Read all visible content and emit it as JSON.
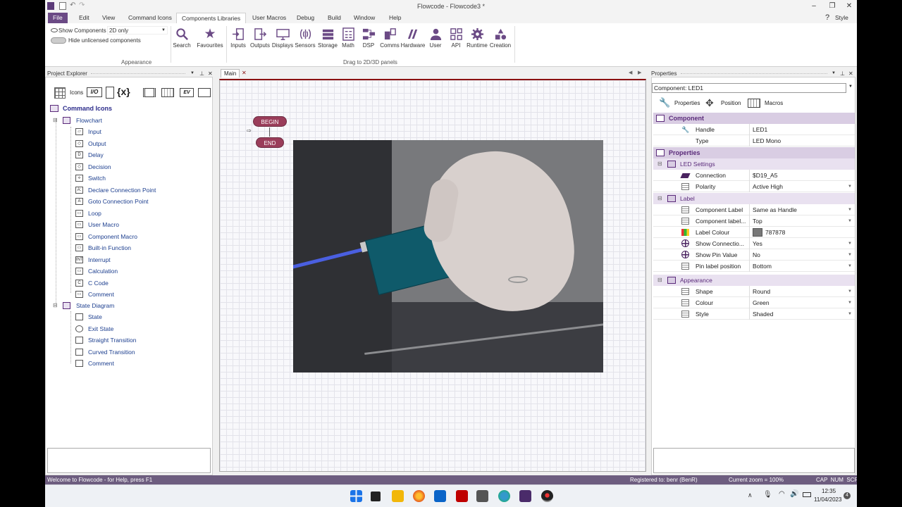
{
  "window": {
    "title": "Flowcode - Flowcode3 *",
    "style_label": "Style"
  },
  "menu": {
    "items": [
      "File",
      "Edit",
      "View",
      "Command Icons",
      "Components Libraries",
      "User Macros",
      "Debug",
      "Build",
      "Window",
      "Help"
    ],
    "active": "Components Libraries"
  },
  "ribbon": {
    "show_components_label": "Show Components",
    "show_components_value": "2D only",
    "hide_unlicensed_label": "Hide unlicensed components",
    "appearance_group": "Appearance",
    "drag_group": "Drag to 2D/3D panels",
    "search": "Search",
    "favourites": "Favourites",
    "libraries": [
      "Inputs",
      "Outputs",
      "Displays",
      "Sensors",
      "Storage",
      "Math",
      "DSP",
      "Comms",
      "Hardware",
      "User",
      "API",
      "Runtime",
      "Creation"
    ]
  },
  "explorer": {
    "title": "Project Explorer",
    "icons_label": "Icons",
    "root": "Command Icons",
    "flowchart": {
      "label": "Flowchart",
      "items": [
        "Input",
        "Output",
        "Delay",
        "Decision",
        "Switch",
        "Declare Connection Point",
        "Goto Connection Point",
        "Loop",
        "User Macro",
        "Component Macro",
        "Built-in Function",
        "Interrupt",
        "Calculation",
        "C Code",
        "Comment"
      ]
    },
    "state_diagram": {
      "label": "State Diagram",
      "items": [
        "State",
        "Exit State",
        "Straight Transition",
        "Curved Transition",
        "Comment"
      ]
    }
  },
  "editor": {
    "tab": "Main",
    "begin": "BEGIN",
    "end": "END"
  },
  "properties": {
    "title": "Properties",
    "component_selector": "Component: LED1",
    "tabs": [
      "Properties",
      "Position",
      "Macros"
    ],
    "component_section": "Component",
    "handle_label": "Handle",
    "handle_value": "LED1",
    "type_label": "Type",
    "type_value": "LED Mono",
    "properties_section": "Properties",
    "led_settings": "LED Settings",
    "connection_label": "Connection",
    "connection_value": "$D19_A5",
    "polarity_label": "Polarity",
    "polarity_value": "Active High",
    "label_group": "Label",
    "component_label_label": "Component Label",
    "component_label_value": "Same as Handle",
    "component_label_pos_label": "Component label...",
    "component_label_pos_value": "Top",
    "label_colour_label": "Label Colour",
    "label_colour_value": "787878",
    "label_colour_hex": "#787878",
    "show_connection_label": "Show Connectio...",
    "show_connection_value": "Yes",
    "show_pin_label": "Show Pin Value",
    "show_pin_value": "No",
    "pin_label_pos_label": "Pin label position",
    "pin_label_pos_value": "Bottom",
    "appearance_group": "Appearance",
    "shape_label": "Shape",
    "shape_value": "Round",
    "colour_label": "Colour",
    "colour_value": "Green",
    "style_label": "Style",
    "style_value": "Shaded"
  },
  "statusbar": {
    "help": "Welcome to Flowcode - for Help, press F1",
    "registered": "Registered to: benr (BenR)",
    "zoom": "Current zoom = 100%",
    "keys": "CAP  NUM  SCRL"
  },
  "taskbar": {
    "time": "12:35",
    "date": "11/04/2023",
    "notification_count": "4"
  },
  "colors": {
    "accent": "#6b4a85",
    "section_bg": "#d9cde3",
    "pill": "#9a3d5a"
  }
}
